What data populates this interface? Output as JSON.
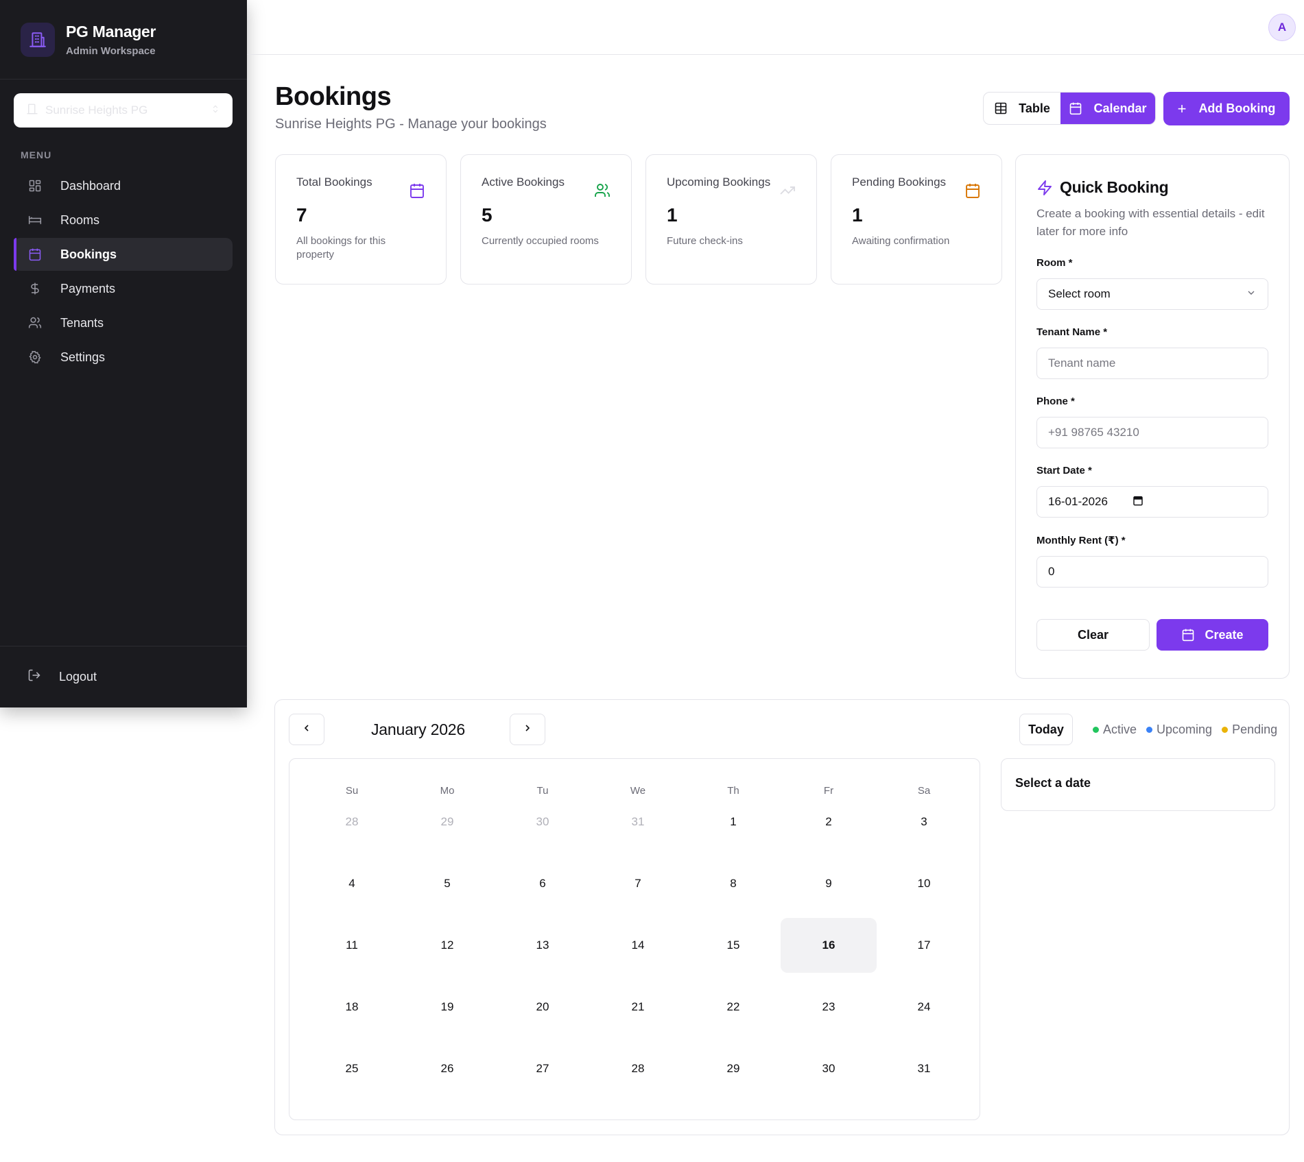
{
  "brand": {
    "title": "PG Manager",
    "subtitle": "Admin Workspace"
  },
  "property_select": {
    "value": "Sunrise Heights PG"
  },
  "menu": {
    "label": "MENU",
    "items": [
      {
        "label": "Dashboard",
        "icon": "dashboard-icon"
      },
      {
        "label": "Rooms",
        "icon": "bed-icon"
      },
      {
        "label": "Bookings",
        "icon": "calendar-icon",
        "active": true
      },
      {
        "label": "Payments",
        "icon": "dollar-icon"
      },
      {
        "label": "Tenants",
        "icon": "users-icon"
      },
      {
        "label": "Settings",
        "icon": "gear-icon"
      }
    ],
    "logout": "Logout"
  },
  "user": {
    "avatar_initial": "A"
  },
  "header": {
    "title": "Bookings",
    "subtitle": "Sunrise Heights PG - Manage your bookings",
    "view_table": "Table",
    "view_calendar": "Calendar",
    "add_booking": "Add Booking"
  },
  "stats": [
    {
      "label": "Total Bookings",
      "value": "7",
      "desc": "All bookings for this property",
      "icon": "calendar-icon",
      "color": "#7c3aed"
    },
    {
      "label": "Active Bookings",
      "value": "5",
      "desc": "Currently occupied rooms",
      "icon": "users-icon",
      "color": "#16a34a"
    },
    {
      "label": "Upcoming Bookings",
      "value": "1",
      "desc": "Future check-ins",
      "icon": "trending-up-icon",
      "color": "#d9d9de"
    },
    {
      "label": "Pending Bookings",
      "value": "1",
      "desc": "Awaiting confirmation",
      "icon": "calendar-icon",
      "color": "#d97706"
    }
  ],
  "quick_booking": {
    "title": "Quick Booking",
    "description": "Create a booking with essential details - edit later for more info",
    "room_label": "Room *",
    "room_value": "Select room",
    "tenant_label": "Tenant Name *",
    "tenant_placeholder": "Tenant name",
    "phone_label": "Phone *",
    "phone_placeholder": "+91 98765 43210",
    "start_label": "Start Date *",
    "start_value": "16-01-2026",
    "rent_label": "Monthly Rent (₹) *",
    "rent_value": "0",
    "clear": "Clear",
    "create": "Create"
  },
  "calendar": {
    "month": "January 2026",
    "today": "Today",
    "legend": [
      {
        "label": "Active",
        "color": "#22c55e"
      },
      {
        "label": "Upcoming",
        "color": "#3b82f6"
      },
      {
        "label": "Pending",
        "color": "#eab308"
      }
    ],
    "weekdays": [
      "Su",
      "Mo",
      "Tu",
      "We",
      "Th",
      "Fr",
      "Sa"
    ],
    "weeks": [
      [
        "28",
        "29",
        "30",
        "31",
        "1",
        "2",
        "3"
      ],
      [
        "4",
        "5",
        "6",
        "7",
        "8",
        "9",
        "10"
      ],
      [
        "11",
        "12",
        "13",
        "14",
        "15",
        "16",
        "17"
      ],
      [
        "18",
        "19",
        "20",
        "21",
        "22",
        "23",
        "24"
      ],
      [
        "25",
        "26",
        "27",
        "28",
        "29",
        "30",
        "31"
      ]
    ],
    "outside_month_first_week": 4,
    "selected_day": "16",
    "detail_title": "Select a date"
  },
  "colors": {
    "accent": "#7c3aed",
    "sidebar_bg": "#1b1b1f"
  }
}
